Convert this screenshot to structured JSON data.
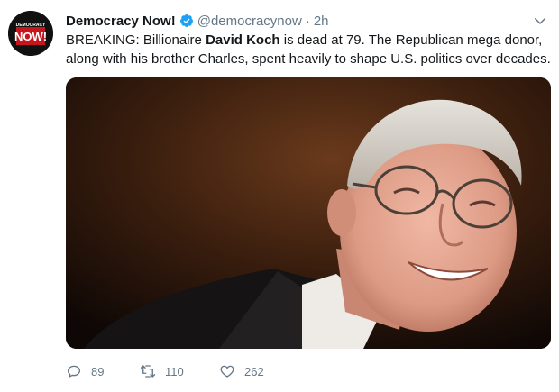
{
  "account": {
    "name": "Democracy Now!",
    "handle": "@democracynow",
    "separator": "·",
    "time": "2h",
    "avatar_logo_top": "DEMOCRACY",
    "avatar_logo_bottom": "NOW!",
    "verified": true,
    "brand_color": "#c4161c"
  },
  "tweet": {
    "line1_pre": "BREAKING: Billionaire ",
    "line1_bold": "David Koch",
    "line1_post": " is dead at 79. The Republican mega donor,",
    "line2": "along with his brother Charles, spent heavily to shape U.S. politics over decades."
  },
  "actions": {
    "replies": "89",
    "retweets": "110",
    "likes": "262"
  },
  "icons": {
    "verified": "verified-badge-icon",
    "menu": "chevron-down-icon",
    "reply": "reply-icon",
    "retweet": "retweet-icon",
    "like": "heart-icon"
  },
  "colors": {
    "text": "#14171a",
    "secondary": "#657786",
    "verified": "#1da1f2"
  }
}
